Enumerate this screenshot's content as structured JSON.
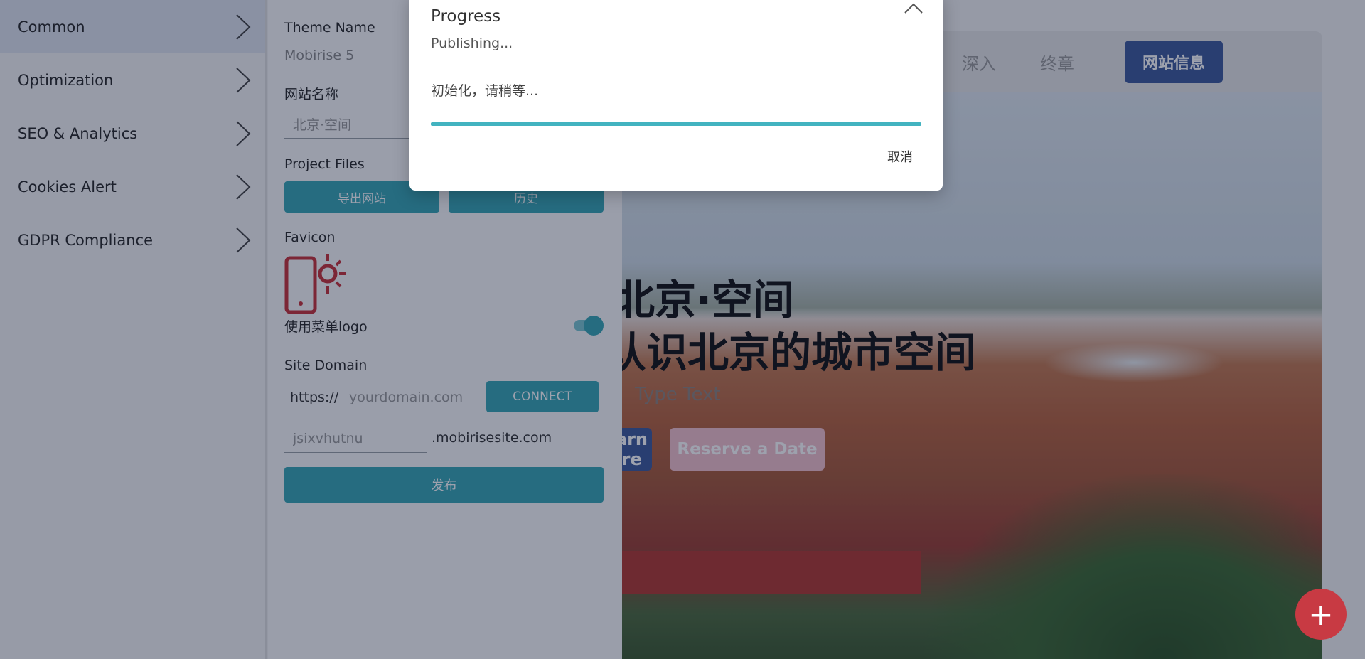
{
  "nav": {
    "items": [
      {
        "label": "Common"
      },
      {
        "label": "Optimization"
      },
      {
        "label": "SEO & Analytics"
      },
      {
        "label": "Cookies Alert"
      },
      {
        "label": "GDPR Compliance"
      }
    ]
  },
  "panel": {
    "theme_label": "Theme Name",
    "theme_value": "Mobirise 5",
    "site_name_label": "网站名称",
    "site_name_placeholder": "北京·空间",
    "project_files_label": "Project Files",
    "export_button": "导出网站",
    "history_button": "历史",
    "favicon_label": "Favicon",
    "menu_logo_label": "使用菜单logo",
    "menu_logo_enabled": true,
    "site_domain_label": "Site Domain",
    "https_prefix": "https://",
    "domain_placeholder": "yourdomain.com",
    "connect_button": "CONNECT",
    "subdomain_placeholder": "jsixvhutnu",
    "subdomain_suffix": ".mobirisesite.com",
    "publish_button": "发布"
  },
  "preview": {
    "nav_links": [
      "深入",
      "终章"
    ],
    "nav_cta": "网站信息",
    "hero_title_line1": "北京·空间",
    "hero_title_line2": "认识北京的城市空间",
    "type_text": "Type Text",
    "learn_button": "Learn More",
    "reserve_button": "Reserve a Date",
    "fab_symbol": "+"
  },
  "modal": {
    "title": "Progress",
    "status": "Publishing...",
    "message": "初始化，请稍等...",
    "progress": 1.0,
    "cancel_button": "取消"
  },
  "colors": {
    "accent": "#3aa7b5",
    "brand_blue": "#3f5b9c",
    "fab_red": "#e23d48"
  }
}
